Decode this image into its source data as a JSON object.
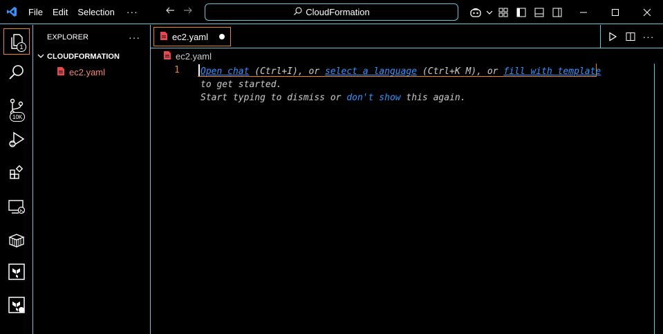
{
  "titlebar": {
    "menu": [
      "File",
      "Edit",
      "Selection"
    ],
    "more": "···",
    "search": "CloudFormation"
  },
  "activity": {
    "explorer_badge": "1",
    "scm_badge": "10K"
  },
  "sidebar": {
    "title": "EXPLORER",
    "more": "···",
    "folder": "CLOUDFORMATION",
    "files": [
      "ec2.yaml"
    ]
  },
  "editor": {
    "tab_label": "ec2.yaml",
    "breadcrumb": "ec2.yaml",
    "line_number": "1",
    "hint": {
      "open_chat": "Open chat",
      "open_chat_key": " (Ctrl+I), or ",
      "select_language": "select a language",
      "select_language_key": " (Ctrl+K M), or ",
      "fill_template": "fill with template",
      "line2": "to get started.",
      "line3_pre": "Start typing to dismiss or ",
      "dont_show": "don't show",
      "line3_post": " this again."
    }
  },
  "colors": {
    "accent_border": "#6fc3df",
    "active_border": "#f38518",
    "link": "#3794ff",
    "file_red": "#f48771"
  }
}
